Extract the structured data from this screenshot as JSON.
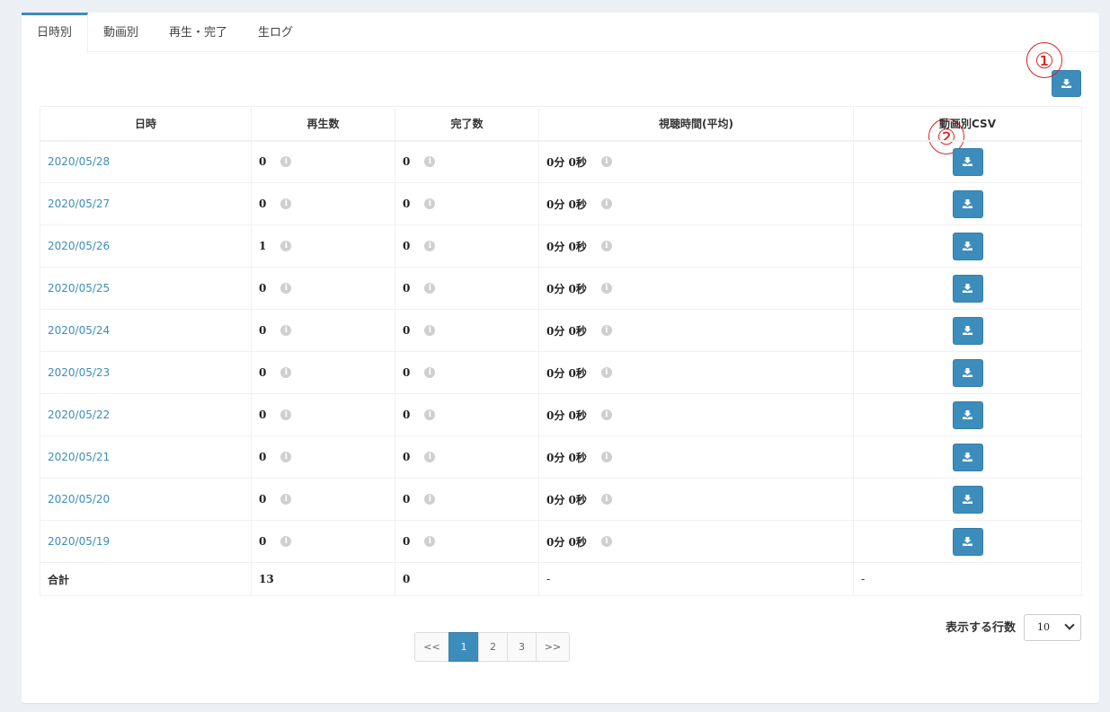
{
  "tabs": [
    "日時別",
    "動画別",
    "再生・完了",
    "生ログ"
  ],
  "annotations": {
    "one": "①",
    "two": "②"
  },
  "table": {
    "headers": [
      "日時",
      "再生数",
      "完了数",
      "視聴時間(平均)",
      "動画別CSV"
    ],
    "rows": [
      {
        "date": "2020/05/28",
        "plays": "0",
        "completions": "0",
        "watch_time": "0分 0秒"
      },
      {
        "date": "2020/05/27",
        "plays": "0",
        "completions": "0",
        "watch_time": "0分 0秒"
      },
      {
        "date": "2020/05/26",
        "plays": "1",
        "completions": "0",
        "watch_time": "0分 0秒"
      },
      {
        "date": "2020/05/25",
        "plays": "0",
        "completions": "0",
        "watch_time": "0分 0秒"
      },
      {
        "date": "2020/05/24",
        "plays": "0",
        "completions": "0",
        "watch_time": "0分 0秒"
      },
      {
        "date": "2020/05/23",
        "plays": "0",
        "completions": "0",
        "watch_time": "0分 0秒"
      },
      {
        "date": "2020/05/22",
        "plays": "0",
        "completions": "0",
        "watch_time": "0分 0秒"
      },
      {
        "date": "2020/05/21",
        "plays": "0",
        "completions": "0",
        "watch_time": "0分 0秒"
      },
      {
        "date": "2020/05/20",
        "plays": "0",
        "completions": "0",
        "watch_time": "0分 0秒"
      },
      {
        "date": "2020/05/19",
        "plays": "0",
        "completions": "0",
        "watch_time": "0分 0秒"
      }
    ],
    "total": {
      "label": "合計",
      "plays": "13",
      "completions": "0",
      "watch_time": "-",
      "csv": "-"
    }
  },
  "info_glyph": "i",
  "pagination": [
    "<<",
    "1",
    "2",
    "3",
    ">>"
  ],
  "pagination_active": "1",
  "rows_per_page": {
    "label": "表示する行数",
    "value": "10"
  },
  "colors": {
    "accent": "#3c8dbc",
    "annotation": "#e02020"
  }
}
